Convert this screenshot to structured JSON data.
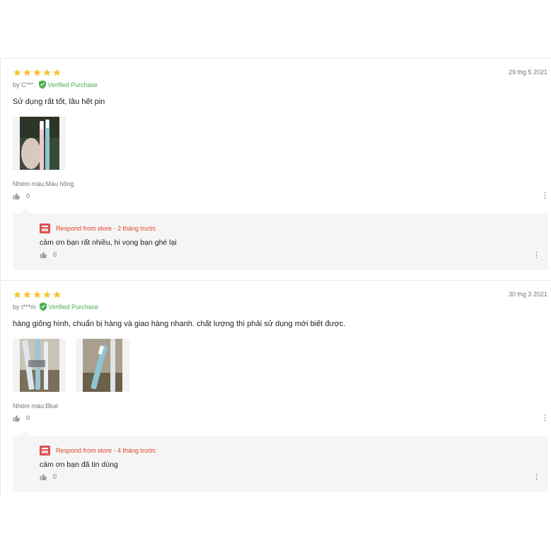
{
  "reviews": [
    {
      "rating": 5,
      "date": "29 thg 5 2021",
      "author": "by C***.",
      "verified": "Verified Purchase",
      "content": "Sử dụng rất tốt, lâu hết pin",
      "sku": "Nhóm màu:Màu hồng",
      "likes": "0",
      "reply": {
        "header": "Respond from store - 2 tháng trước",
        "content": "cảm ơn bạn rất nhiều, hi vọng bạn ghé lại",
        "likes": "0"
      }
    },
    {
      "rating": 5,
      "date": "30 thg 3 2021",
      "author": "by t***m",
      "verified": "Verified Purchase",
      "content": "hàng giống hình, chuẩn bị hàng và giao hàng nhanh. chất lượng thì phải sử dụng mới biết được.",
      "sku": "Nhóm màu:Blue",
      "likes": "0",
      "reply": {
        "header": "Respond from store - 4 tháng trước",
        "content": "cảm ơn bạn đã tin dùng",
        "likes": "0"
      }
    }
  ],
  "colors": {
    "star": "#f7c53b",
    "verified": "#4caf50",
    "store_reply": "#e0452b"
  }
}
